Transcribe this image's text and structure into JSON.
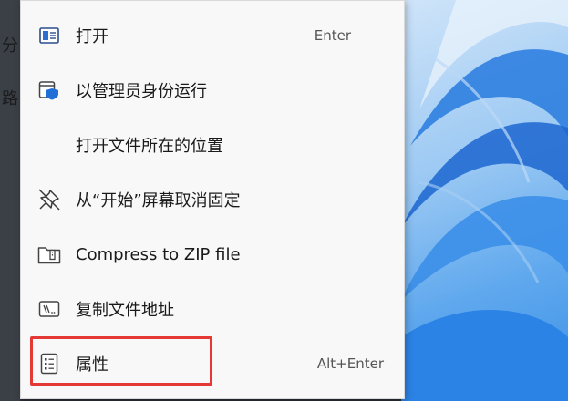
{
  "background": {
    "left_text_1": "分",
    "left_text_2": "路"
  },
  "menu": {
    "items": [
      {
        "label": "打开",
        "shortcut": "Enter",
        "icon": "open-window-icon"
      },
      {
        "label": "以管理员身份运行",
        "shortcut": "",
        "icon": "shield-admin-icon"
      },
      {
        "label": "打开文件所在的位置",
        "shortcut": "",
        "icon": ""
      },
      {
        "label": "从“开始”屏幕取消固定",
        "shortcut": "",
        "icon": "unpin-icon"
      },
      {
        "label": "Compress to ZIP file",
        "shortcut": "",
        "icon": "zip-folder-icon"
      },
      {
        "label": "复制文件地址",
        "shortcut": "",
        "icon": "copy-path-icon"
      },
      {
        "label": "属性",
        "shortcut": "Alt+Enter",
        "icon": "properties-icon"
      }
    ]
  },
  "colors": {
    "highlight": "#e53935",
    "menu_bg": "#f8f8f8",
    "accent": "#1f6fd6"
  }
}
